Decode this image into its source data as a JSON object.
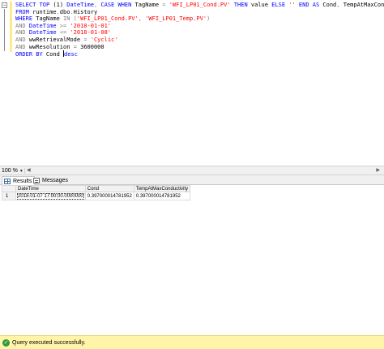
{
  "editor": {
    "lines": [
      [
        {
          "t": "SELECT",
          "c": "kw"
        },
        {
          "t": " ",
          "c": "txt"
        },
        {
          "t": "TOP",
          "c": "kw"
        },
        {
          "t": " (1) ",
          "c": "txt"
        },
        {
          "t": "DateTime",
          "c": "kw"
        },
        {
          "t": ", ",
          "c": "op"
        },
        {
          "t": "CASE WHEN",
          "c": "kw"
        },
        {
          "t": " TagName ",
          "c": "txt"
        },
        {
          "t": "=",
          "c": "op"
        },
        {
          "t": " 'WFI_LP01_Cond.PV'",
          "c": "str"
        },
        {
          "t": " ",
          "c": "txt"
        },
        {
          "t": "THEN",
          "c": "kw"
        },
        {
          "t": " value ",
          "c": "txt"
        },
        {
          "t": "ELSE",
          "c": "kw"
        },
        {
          "t": " '' ",
          "c": "str"
        },
        {
          "t": "END",
          "c": "kw"
        },
        {
          "t": " ",
          "c": "txt"
        },
        {
          "t": "AS",
          "c": "kw"
        },
        {
          "t": " Cond",
          "c": "txt"
        },
        {
          "t": ",",
          "c": "op"
        },
        {
          "t": " TempAtMaxConductivity ",
          "c": "txt"
        },
        {
          "t": "=",
          "c": "op"
        },
        {
          "t": " value",
          "c": "txt"
        }
      ],
      [
        {
          "t": "FROM",
          "c": "kw"
        },
        {
          "t": " runtime",
          "c": "txt"
        },
        {
          "t": ".",
          "c": "op"
        },
        {
          "t": "dbo",
          "c": "txt"
        },
        {
          "t": ".",
          "c": "op"
        },
        {
          "t": "History",
          "c": "txt"
        }
      ],
      [
        {
          "t": "WHERE",
          "c": "kw"
        },
        {
          "t": " TagName ",
          "c": "txt"
        },
        {
          "t": "IN",
          "c": "op"
        },
        {
          "t": " (",
          "c": "op"
        },
        {
          "t": "'WFI_LP01_Cond.PV'",
          "c": "str"
        },
        {
          "t": ", ",
          "c": "op"
        },
        {
          "t": "'WFI_LP01_Temp.PV'",
          "c": "str"
        },
        {
          "t": ")",
          "c": "op"
        }
      ],
      [
        {
          "t": "AND",
          "c": "op"
        },
        {
          "t": " ",
          "c": "txt"
        },
        {
          "t": "DateTime",
          "c": "kw"
        },
        {
          "t": " >= ",
          "c": "op"
        },
        {
          "t": "'2018-01-01'",
          "c": "str"
        }
      ],
      [
        {
          "t": "AND",
          "c": "op"
        },
        {
          "t": " ",
          "c": "txt"
        },
        {
          "t": "DateTime",
          "c": "kw"
        },
        {
          "t": " <= ",
          "c": "op"
        },
        {
          "t": "'2018-01-08'",
          "c": "str"
        }
      ],
      [
        {
          "t": "AND",
          "c": "op"
        },
        {
          "t": " wwRetrievalMode ",
          "c": "txt"
        },
        {
          "t": "=",
          "c": "op"
        },
        {
          "t": " 'Cyclic'",
          "c": "str"
        }
      ],
      [
        {
          "t": "AND",
          "c": "op"
        },
        {
          "t": " wwResolution ",
          "c": "txt"
        },
        {
          "t": "=",
          "c": "op"
        },
        {
          "t": " 3600000",
          "c": "txt"
        }
      ],
      [
        {
          "t": "ORDER BY",
          "c": "kw"
        },
        {
          "t": " Cond ",
          "c": "txt"
        },
        {
          "t": "|",
          "c": "caret"
        },
        {
          "t": "desc",
          "c": "kw"
        }
      ]
    ]
  },
  "zoom": {
    "value": "100 %"
  },
  "tabs": {
    "results_label": "Results",
    "messages_label": "Messages"
  },
  "results": {
    "columns": [
      "DateTime",
      "Cond",
      "TempAtMaxConductivity"
    ],
    "rows": [
      {
        "num": "1",
        "cells": [
          "2018-01-07 17:00:00.0000000",
          "0.397000014781952",
          "0.397000014781952"
        ]
      }
    ]
  },
  "status": {
    "text": "Query executed successfully."
  },
  "icons": {
    "collapse": "collapse-minus-icon",
    "results_tab": "results-grid-icon",
    "messages_tab": "messages-icon",
    "status": "success-check-icon"
  },
  "colors": {
    "keyword": "#0000ff",
    "string": "#ff0000",
    "operator": "#808080",
    "status_bar": "#fff4a8",
    "success": "#2e9b3c"
  }
}
